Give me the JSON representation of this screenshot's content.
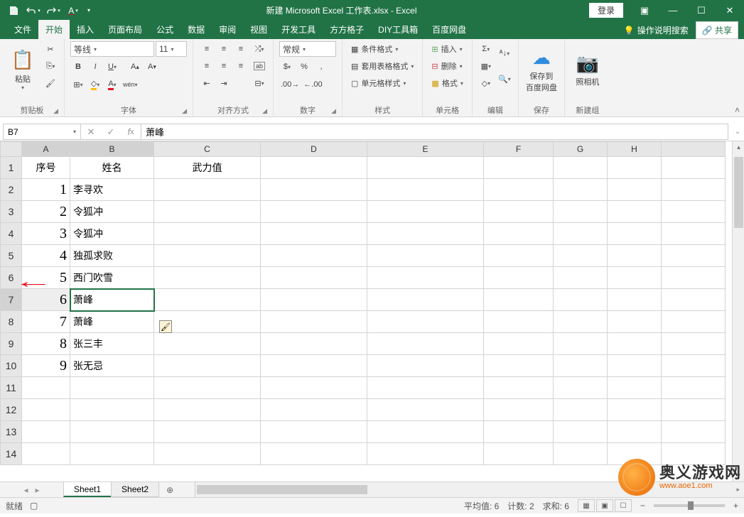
{
  "titlebar": {
    "title": "新建 Microsoft Excel 工作表.xlsx  -  Excel",
    "login": "登录"
  },
  "tabs": {
    "file": "文件",
    "home": "开始",
    "insert": "插入",
    "layout": "页面布局",
    "formulas": "公式",
    "data": "数据",
    "review": "审阅",
    "view": "视图",
    "dev": "开发工具",
    "fanggz": "方方格子",
    "diy": "DIY工具箱",
    "baidu": "百度网盘",
    "help": "操作说明搜索",
    "share": "共享"
  },
  "ribbon": {
    "clipboard": {
      "paste": "粘贴",
      "label": "剪贴板"
    },
    "font": {
      "name": "等线",
      "size": "11",
      "label": "字体",
      "phonetic": "wén"
    },
    "align": {
      "label": "对齐方式",
      "wrap": "ab"
    },
    "number": {
      "format": "常规",
      "label": "数字"
    },
    "styles": {
      "cond": "条件格式",
      "table": "套用表格格式",
      "cell": "单元格样式",
      "label": "样式"
    },
    "cells": {
      "insert": "插入",
      "delete": "删除",
      "format": "格式",
      "label": "单元格"
    },
    "editing": {
      "label": "编辑"
    },
    "baidu": {
      "save": "保存到",
      "save2": "百度网盘",
      "label": "保存"
    },
    "camera": {
      "btn": "照相机",
      "label": "新建组"
    }
  },
  "namebox": "B7",
  "formula": "萧峰",
  "columns": [
    "A",
    "B",
    "C",
    "D",
    "E",
    "F",
    "G",
    "H"
  ],
  "headers": {
    "seq": "序号",
    "name": "姓名",
    "power": "武力值"
  },
  "rows": [
    {
      "n": "1",
      "name": "李寻欢"
    },
    {
      "n": "2",
      "name": "令狐冲"
    },
    {
      "n": "3",
      "name": "令狐冲"
    },
    {
      "n": "4",
      "name": "独孤求败"
    },
    {
      "n": "5",
      "name": "西门吹雪"
    },
    {
      "n": "6",
      "name": "萧峰"
    },
    {
      "n": "7",
      "name": "萧峰"
    },
    {
      "n": "8",
      "name": "张三丰"
    },
    {
      "n": "9",
      "name": "张无忌"
    }
  ],
  "sheets": {
    "s1": "Sheet1",
    "s2": "Sheet2"
  },
  "status": {
    "ready": "就绪",
    "avg": "平均值: 6",
    "count": "计数: 2",
    "sum": "求和: 6"
  },
  "watermark": {
    "cn": "奥义游戏网",
    "en": "www.aoe1.com"
  }
}
